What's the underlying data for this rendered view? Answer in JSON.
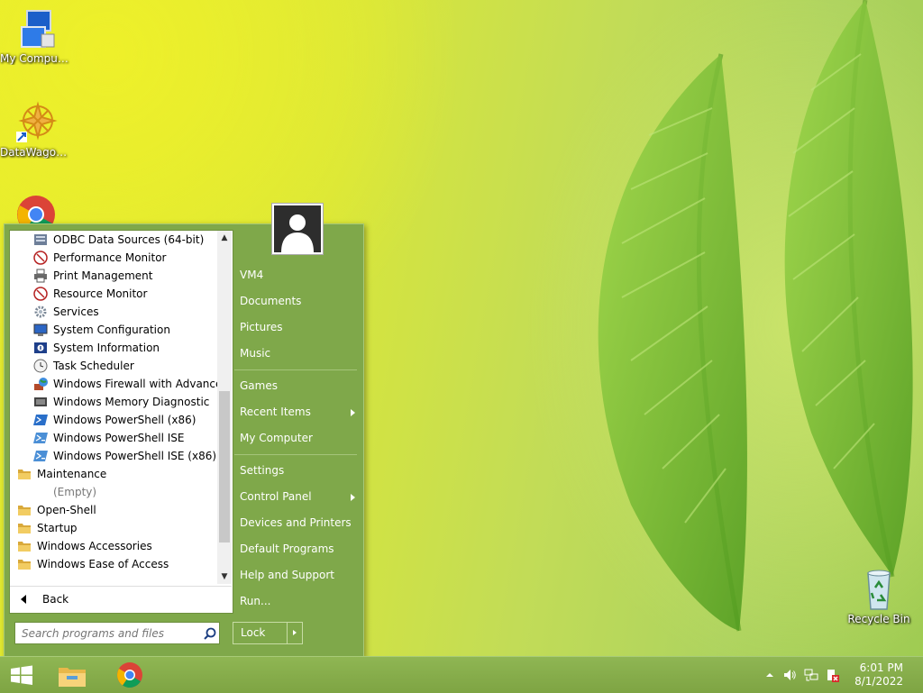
{
  "desktop": {
    "icons": [
      {
        "label": "My Computer"
      },
      {
        "label": "DataWagon..."
      },
      {
        "label": ""
      },
      {
        "label": "Recycle Bin"
      }
    ]
  },
  "start_menu": {
    "programs": [
      {
        "label": "ODBC Data Sources (64-bit)",
        "icon": "odbc-icon",
        "kind": "item"
      },
      {
        "label": "Performance Monitor",
        "icon": "performance-monitor-icon",
        "kind": "item"
      },
      {
        "label": "Print Management",
        "icon": "printer-icon",
        "kind": "item"
      },
      {
        "label": "Resource Monitor",
        "icon": "resource-monitor-icon",
        "kind": "item"
      },
      {
        "label": "Services",
        "icon": "gear-icon",
        "kind": "item"
      },
      {
        "label": "System Configuration",
        "icon": "system-config-icon",
        "kind": "item"
      },
      {
        "label": "System Information",
        "icon": "system-info-icon",
        "kind": "item"
      },
      {
        "label": "Task Scheduler",
        "icon": "clock-icon",
        "kind": "item"
      },
      {
        "label": "Windows Firewall with Advanced",
        "icon": "firewall-icon",
        "kind": "item"
      },
      {
        "label": "Windows Memory Diagnostic",
        "icon": "memory-chip-icon",
        "kind": "item"
      },
      {
        "label": "Windows PowerShell (x86)",
        "icon": "powershell-icon",
        "kind": "item"
      },
      {
        "label": "Windows PowerShell ISE",
        "icon": "powershell-ise-icon",
        "kind": "item"
      },
      {
        "label": "Windows PowerShell ISE (x86)",
        "icon": "powershell-ise-icon",
        "kind": "item"
      },
      {
        "label": "Maintenance",
        "icon": "folder-icon",
        "kind": "folder"
      },
      {
        "label": "(Empty)",
        "icon": "",
        "kind": "empty"
      },
      {
        "label": "Open-Shell",
        "icon": "folder-icon",
        "kind": "folder"
      },
      {
        "label": "Startup",
        "icon": "folder-icon",
        "kind": "folder"
      },
      {
        "label": "Windows Accessories",
        "icon": "folder-icon",
        "kind": "folder"
      },
      {
        "label": "Windows Ease of Access",
        "icon": "folder-icon",
        "kind": "folder"
      }
    ],
    "back_label": "Back",
    "search_placeholder": "Search programs and files",
    "right_items": [
      {
        "label": "VM4",
        "submenu": false
      },
      {
        "label": "Documents",
        "submenu": false
      },
      {
        "label": "Pictures",
        "submenu": false
      },
      {
        "label": "Music",
        "submenu": false
      },
      {
        "label": "---"
      },
      {
        "label": "Games",
        "submenu": false
      },
      {
        "label": "Recent Items",
        "submenu": true
      },
      {
        "label": "My Computer",
        "submenu": false
      },
      {
        "label": "---"
      },
      {
        "label": "Settings",
        "submenu": false
      },
      {
        "label": "Control Panel",
        "submenu": true
      },
      {
        "label": "Devices and Printers",
        "submenu": false
      },
      {
        "label": "Default Programs",
        "submenu": false
      },
      {
        "label": "Help and Support",
        "submenu": false
      },
      {
        "label": "Run...",
        "submenu": false
      }
    ],
    "lock_label": "Lock"
  },
  "taskbar": {
    "time": "6:01 PM",
    "date": "8/1/2022"
  },
  "colors": {
    "menu_green": "#7fa84a",
    "taskbar_green": "#86ad4a"
  }
}
